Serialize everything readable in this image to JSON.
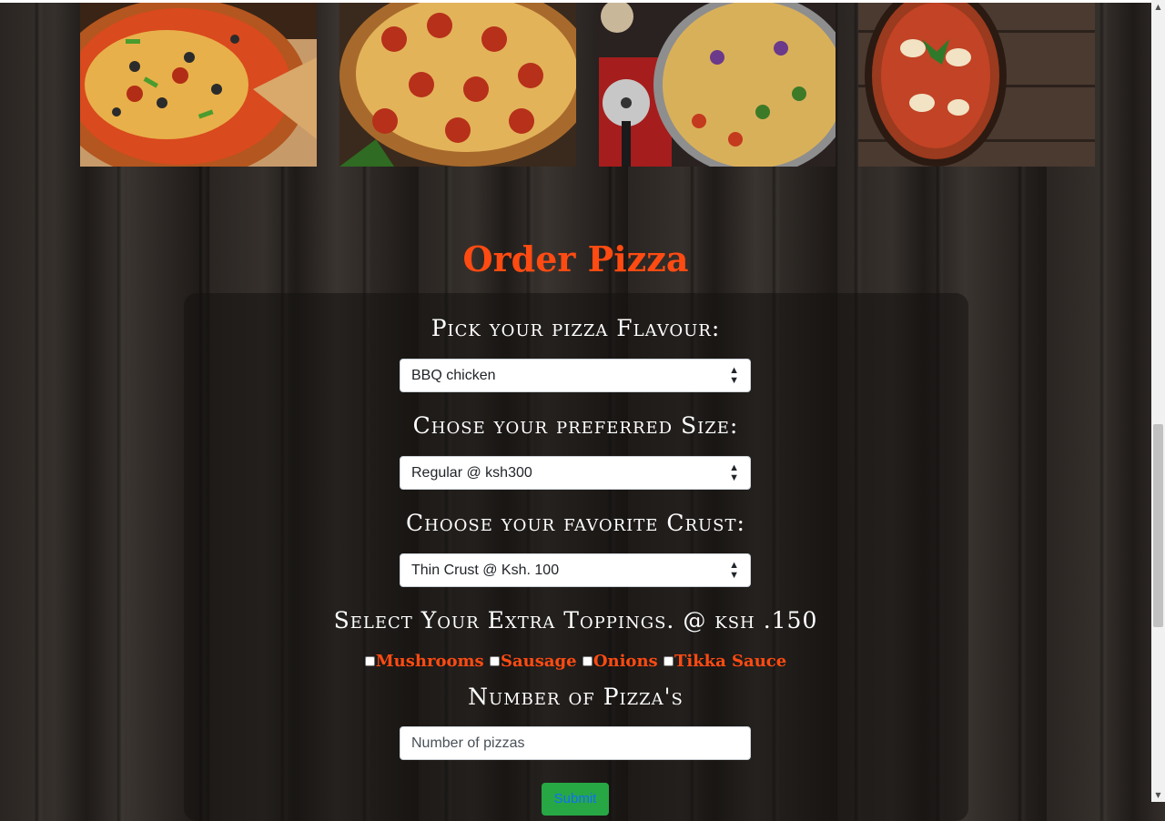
{
  "gallery": {
    "images": [
      {
        "alt": "pizza-supreme-image"
      },
      {
        "alt": "pizza-pepperoni-image"
      },
      {
        "alt": "pizza-veggie-image"
      },
      {
        "alt": "pizza-margherita-image"
      }
    ]
  },
  "order": {
    "title": "Order Pizza",
    "flavour_label": "Pick your pizza Flavour:",
    "flavour_selected": "BBQ chicken",
    "size_label": "Chose your preferred Size:",
    "size_selected": "Regular @ ksh300",
    "crust_label": "Choose your favorite Crust:",
    "crust_selected": "Thin Crust @ Ksh. 100",
    "toppings_label": "Select Your Extra Toppings. @ ksh .150",
    "toppings": [
      {
        "label": "Mushrooms",
        "checked": false
      },
      {
        "label": "Sausage",
        "checked": false
      },
      {
        "label": "Onions",
        "checked": false
      },
      {
        "label": "Tikka Sauce",
        "checked": false
      }
    ],
    "quantity_label": "Number of Pizza's",
    "quantity_placeholder": "Number of pizzas",
    "submit_label": "Submit"
  },
  "colors": {
    "accent": "#ff4b12",
    "submit_bg": "#28a745",
    "submit_text": "#0d6efd"
  }
}
